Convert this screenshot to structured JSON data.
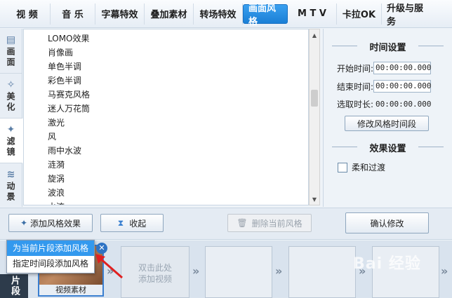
{
  "top_tabs": [
    {
      "label": "视  频",
      "active": false
    },
    {
      "label": "音  乐",
      "active": false
    },
    {
      "label": "字幕特效",
      "active": false
    },
    {
      "label": "叠加素材",
      "active": false
    },
    {
      "label": "转场特效",
      "active": false
    },
    {
      "label": "画面风格",
      "active": true
    },
    {
      "label": "M T V",
      "active": false
    },
    {
      "label": "卡拉OK",
      "active": false
    },
    {
      "label": "升级与服务",
      "active": false
    }
  ],
  "side_tabs": [
    {
      "label": "画面",
      "icon": "frame-icon",
      "active": false
    },
    {
      "label": "美化",
      "icon": "wand-icon",
      "active": false
    },
    {
      "label": "滤镜",
      "icon": "sparkle-wand-icon",
      "active": true
    },
    {
      "label": "动景",
      "icon": "wave-icon",
      "active": false
    }
  ],
  "effects": [
    "LOMO效果",
    "肖像画",
    "单色半调",
    "彩色半调",
    "马赛克风格",
    "迷人万花筒",
    "激光",
    "风",
    "雨中水波",
    "涟漪",
    "旋涡",
    "波浪",
    "水流"
  ],
  "time_settings": {
    "title": "时间设置",
    "start_label": "开始时间:",
    "start_value": "00:00:00.000",
    "end_label": "结束时间:",
    "end_value": "00:00:00.000",
    "duration_label": "选取时长:",
    "duration_value": "00:00:00.000",
    "modify_button": "修改风格时间段"
  },
  "effect_settings": {
    "title": "效果设置",
    "smooth_transition": "柔和过渡",
    "smooth_checked": false
  },
  "actions": {
    "add_effect": "添加风格效果",
    "collapse": "收起",
    "delete_current": "删除当前风格",
    "confirm": "确认修改"
  },
  "dropdown": {
    "items": [
      "为当前片段添加风格",
      "指定时间段添加风格"
    ],
    "highlighted": 0
  },
  "timeline": {
    "segment_label": "片段",
    "clip_caption": "视频素材",
    "add_video_line1": "双击此处",
    "add_video_line2": "添加视频"
  },
  "watermark": "Bai 经验",
  "colors": {
    "accent": "#1a7fd6",
    "highlight": "#3399ee",
    "red_arrow": "#e02020"
  }
}
